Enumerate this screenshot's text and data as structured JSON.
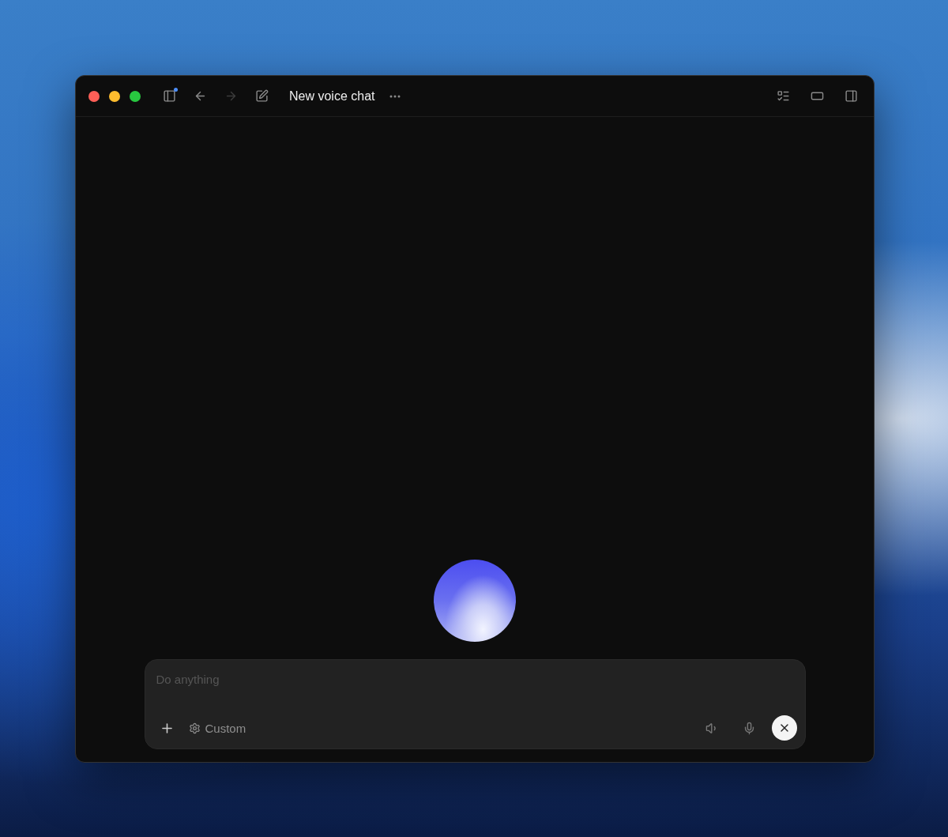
{
  "window": {
    "title": "New voice chat"
  },
  "toolbar": {
    "back": {
      "disabled": false
    },
    "forward": {
      "disabled": true
    }
  },
  "composer": {
    "placeholder": "Do anything",
    "mode_label": "Custom"
  }
}
